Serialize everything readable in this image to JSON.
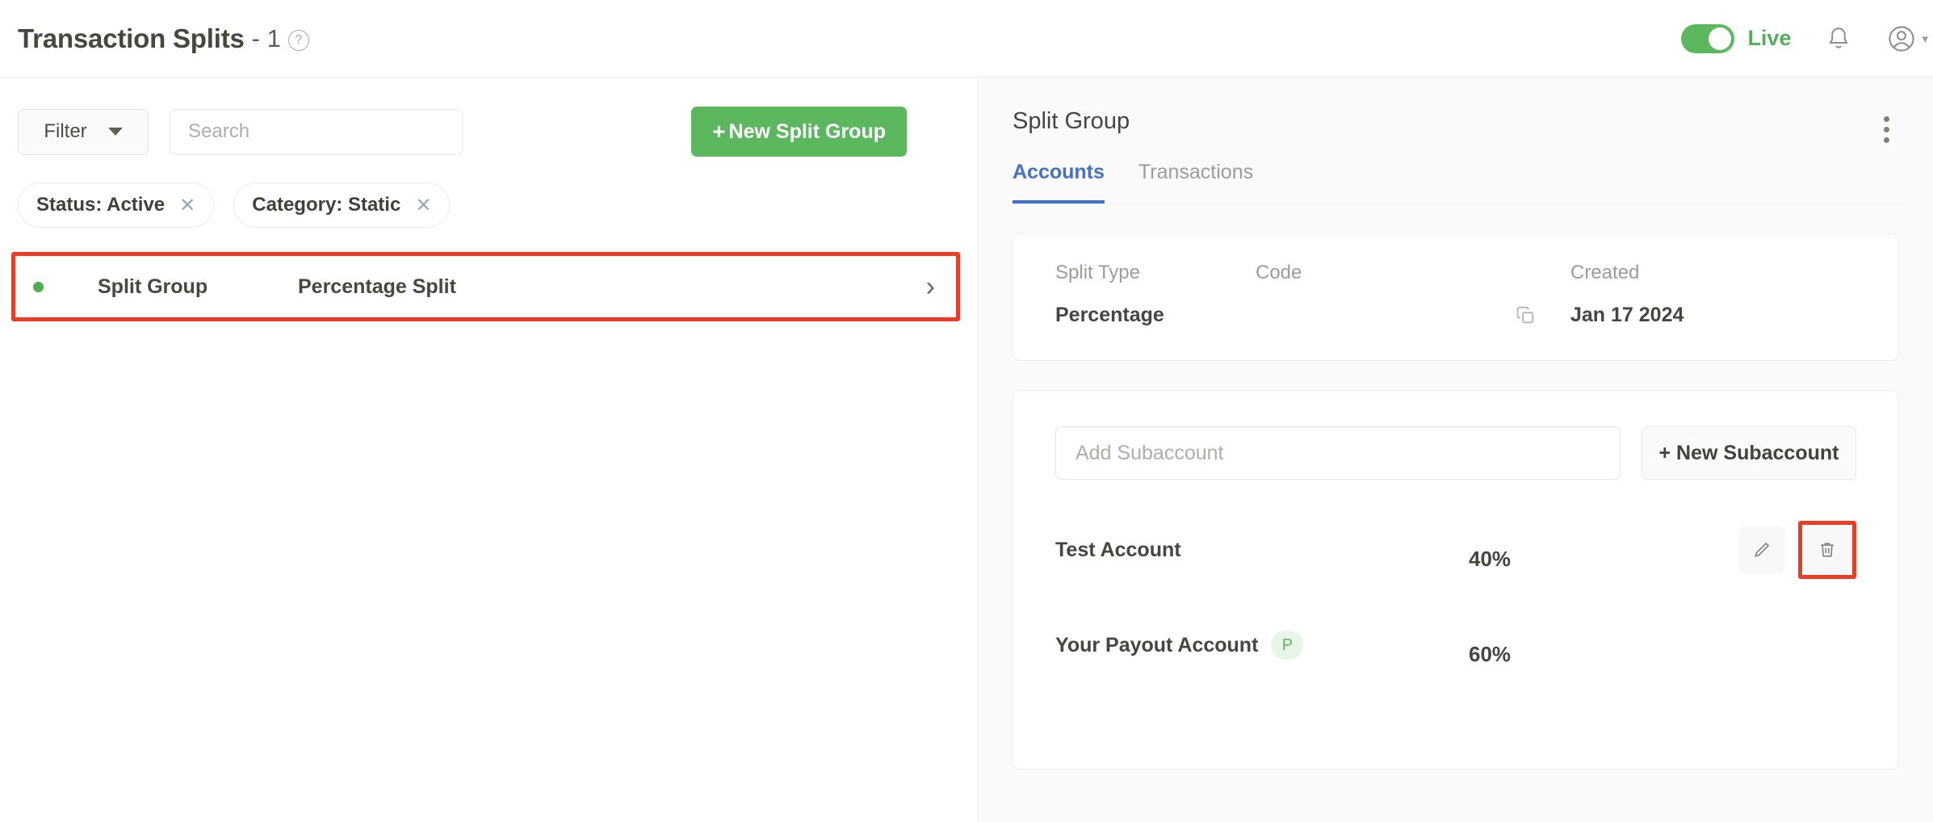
{
  "header": {
    "title": "Transaction Splits",
    "count_separator": "- 1",
    "help_icon": "question-circle-icon",
    "live_toggle_label": "Live",
    "toggle_on": true,
    "notification_icon": "bell-icon",
    "avatar_icon": "user-avatar-icon",
    "accent_green": "#5cb85f"
  },
  "left": {
    "filter_button_label": "Filter",
    "search_placeholder": "Search",
    "search_value": "",
    "new_split_group_label": "New Split Group",
    "new_split_group_plus": "+",
    "chips": [
      {
        "label": "Status: Active",
        "remove_icon": "close-icon"
      },
      {
        "label": "Category: Static",
        "remove_icon": "close-icon"
      }
    ],
    "rows": [
      {
        "status": "active",
        "name": "Split Group",
        "type": "Percentage Split",
        "chevron": "›",
        "highlight_color": "#ee3b23"
      }
    ]
  },
  "right": {
    "panel_title": "Split Group",
    "kebab_icon": "more-vertical-icon",
    "tabs": [
      {
        "label": "Accounts",
        "active": true
      },
      {
        "label": "Transactions",
        "active": false
      }
    ],
    "info": {
      "split_type_label": "Split Type",
      "split_type_value": "Percentage",
      "code_label": "Code",
      "code_value": "",
      "copy_icon": "copy-icon",
      "created_label": "Created",
      "created_value": "Jan 17 2024"
    },
    "accounts": {
      "add_placeholder": "Add Subaccount",
      "add_value": "",
      "new_subaccount_label": "+ New Subaccount",
      "rows": [
        {
          "name": "Test Account",
          "badge": "",
          "percent": "40%",
          "edit_icon": "pencil-icon",
          "delete_icon": "trash-icon",
          "show_actions": true,
          "delete_highlighted": true
        },
        {
          "name": "Your Payout Account",
          "badge": "P",
          "percent": "60%",
          "edit_icon": "pencil-icon",
          "delete_icon": "trash-icon",
          "show_actions": false,
          "delete_highlighted": false
        }
      ]
    }
  }
}
